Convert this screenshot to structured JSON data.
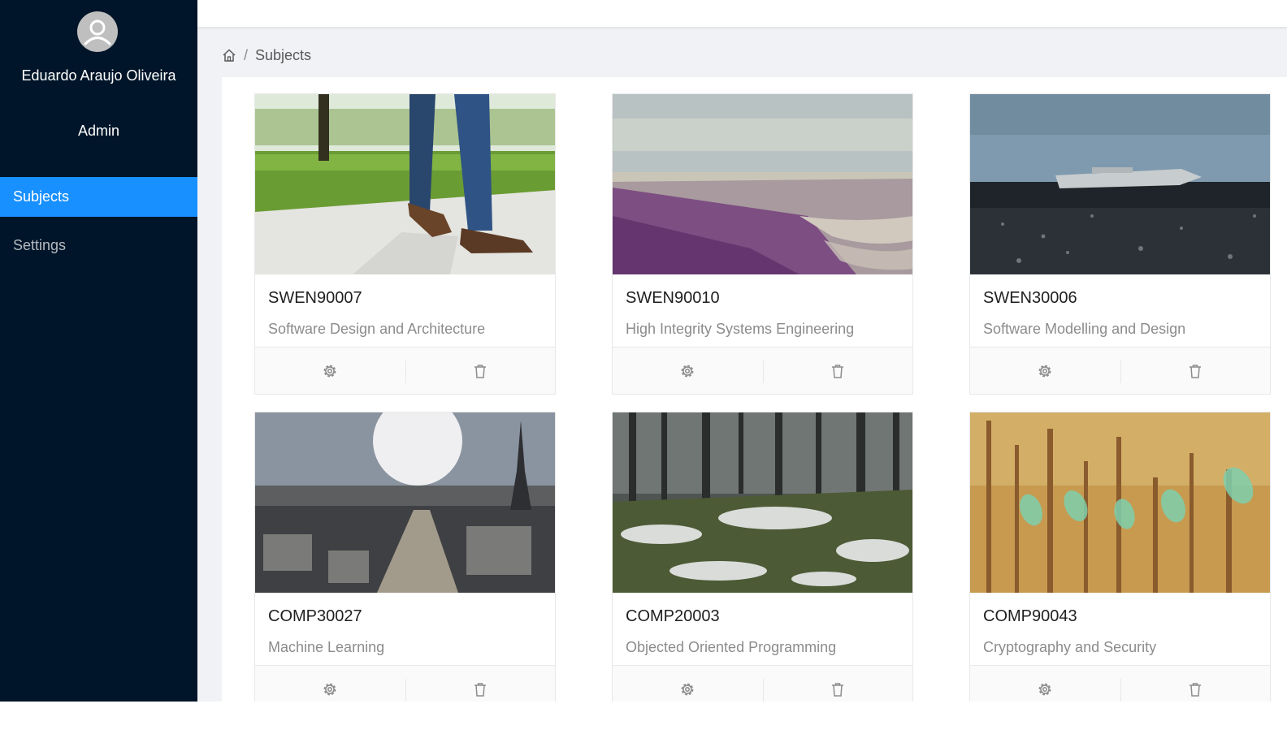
{
  "user": {
    "name": "Eduardo Araujo Oliveira",
    "role": "Admin"
  },
  "menu": [
    {
      "label": "Subjects",
      "active": true
    },
    {
      "label": "Settings",
      "active": false
    }
  ],
  "breadcrumb": {
    "home_icon": "home-icon",
    "separator": "/",
    "current": "Subjects"
  },
  "subjects": [
    {
      "code": "SWEN90007",
      "name": "Software Design and Architecture",
      "image": "walking-on-grass-photo"
    },
    {
      "code": "SWEN90010",
      "name": "High Integrity Systems Engineering",
      "image": "beach-shoreline-photo"
    },
    {
      "code": "SWEN30006",
      "name": "Software Modelling and Design",
      "image": "plane-wreck-photo"
    },
    {
      "code": "COMP30027",
      "name": "Machine Learning",
      "image": "paris-skyline-photo"
    },
    {
      "code": "COMP20003",
      "name": "Objected Oriented Programming",
      "image": "snowy-forest-photo"
    },
    {
      "code": "COMP90043",
      "name": "Cryptography and Security",
      "image": "glass-bottles-on-sticks-photo"
    }
  ],
  "card_actions": {
    "settings_icon": "settings-icon",
    "delete_icon": "delete-icon"
  }
}
